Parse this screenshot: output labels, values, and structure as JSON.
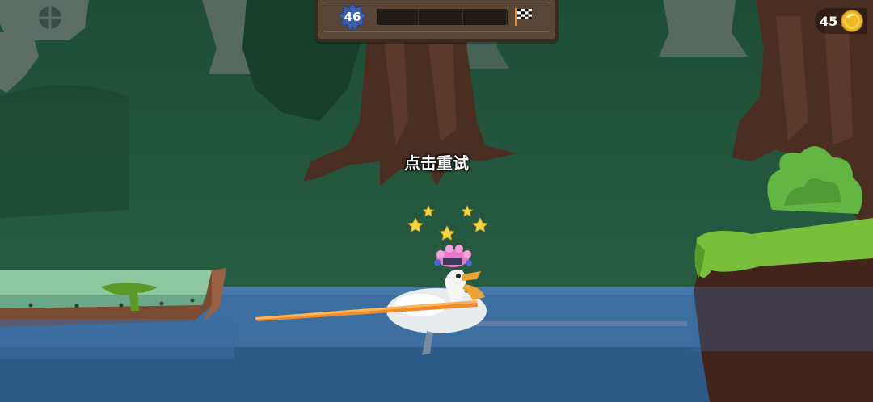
{
  "hud": {
    "level_number": "46",
    "level_progress": 0,
    "coins": "45"
  },
  "prompt": {
    "retry_text": "点击重试"
  },
  "icons": {
    "level_badge": "blue-star-badge-icon",
    "finish": "checkered-flag-icon",
    "coin": "gold-coin-icon",
    "dizzy": "star-icon"
  },
  "colors": {
    "water": "#3c6ea0",
    "grass": "#7abf3b",
    "coin_gold": "#f1b722",
    "badge_blue": "#3f5fb0",
    "pole_orange": "#f08a2a"
  }
}
